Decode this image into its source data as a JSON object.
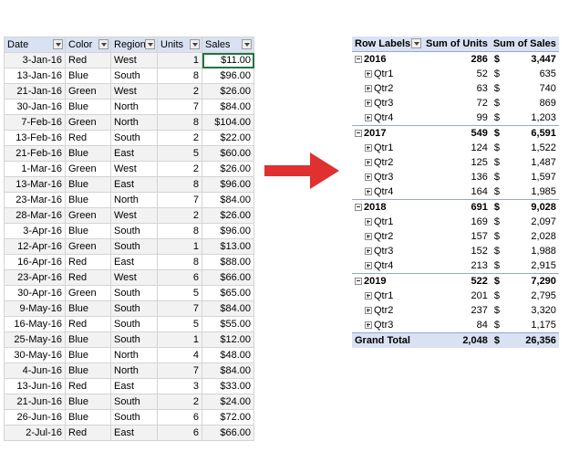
{
  "source": {
    "headers": [
      "Date",
      "Color",
      "Region",
      "Units",
      "Sales"
    ],
    "rows": [
      [
        "3-Jan-16",
        "Red",
        "West",
        "1",
        "$11.00"
      ],
      [
        "13-Jan-16",
        "Blue",
        "South",
        "8",
        "$96.00"
      ],
      [
        "21-Jan-16",
        "Green",
        "West",
        "2",
        "$26.00"
      ],
      [
        "30-Jan-16",
        "Blue",
        "North",
        "7",
        "$84.00"
      ],
      [
        "7-Feb-16",
        "Green",
        "North",
        "8",
        "$104.00"
      ],
      [
        "13-Feb-16",
        "Red",
        "South",
        "2",
        "$22.00"
      ],
      [
        "21-Feb-16",
        "Blue",
        "East",
        "5",
        "$60.00"
      ],
      [
        "1-Mar-16",
        "Green",
        "West",
        "2",
        "$26.00"
      ],
      [
        "13-Mar-16",
        "Blue",
        "East",
        "8",
        "$96.00"
      ],
      [
        "23-Mar-16",
        "Blue",
        "North",
        "7",
        "$84.00"
      ],
      [
        "28-Mar-16",
        "Green",
        "West",
        "2",
        "$26.00"
      ],
      [
        "3-Apr-16",
        "Blue",
        "South",
        "8",
        "$96.00"
      ],
      [
        "12-Apr-16",
        "Green",
        "South",
        "1",
        "$13.00"
      ],
      [
        "16-Apr-16",
        "Red",
        "East",
        "8",
        "$88.00"
      ],
      [
        "23-Apr-16",
        "Red",
        "West",
        "6",
        "$66.00"
      ],
      [
        "30-Apr-16",
        "Green",
        "South",
        "5",
        "$65.00"
      ],
      [
        "9-May-16",
        "Blue",
        "South",
        "7",
        "$84.00"
      ],
      [
        "16-May-16",
        "Red",
        "South",
        "5",
        "$55.00"
      ],
      [
        "25-May-16",
        "Blue",
        "South",
        "1",
        "$12.00"
      ],
      [
        "30-May-16",
        "Blue",
        "North",
        "4",
        "$48.00"
      ],
      [
        "4-Jun-16",
        "Blue",
        "North",
        "7",
        "$84.00"
      ],
      [
        "13-Jun-16",
        "Red",
        "East",
        "3",
        "$33.00"
      ],
      [
        "21-Jun-16",
        "Blue",
        "South",
        "2",
        "$24.00"
      ],
      [
        "26-Jun-16",
        "Blue",
        "South",
        "6",
        "$72.00"
      ],
      [
        "2-Jul-16",
        "Red",
        "East",
        "6",
        "$66.00"
      ]
    ]
  },
  "pivot": {
    "headers": {
      "row_labels": "Row Labels",
      "units": "Sum of Units",
      "sales": "Sum of Sales"
    },
    "currency_symbol": "$",
    "groups": [
      {
        "label": "2016",
        "units": "286",
        "sales": "3,447",
        "quarters": [
          {
            "label": "Qtr1",
            "units": "52",
            "sales": "635"
          },
          {
            "label": "Qtr2",
            "units": "63",
            "sales": "740"
          },
          {
            "label": "Qtr3",
            "units": "72",
            "sales": "869"
          },
          {
            "label": "Qtr4",
            "units": "99",
            "sales": "1,203"
          }
        ]
      },
      {
        "label": "2017",
        "units": "549",
        "sales": "6,591",
        "quarters": [
          {
            "label": "Qtr1",
            "units": "124",
            "sales": "1,522"
          },
          {
            "label": "Qtr2",
            "units": "125",
            "sales": "1,487"
          },
          {
            "label": "Qtr3",
            "units": "136",
            "sales": "1,597"
          },
          {
            "label": "Qtr4",
            "units": "164",
            "sales": "1,985"
          }
        ]
      },
      {
        "label": "2018",
        "units": "691",
        "sales": "9,028",
        "quarters": [
          {
            "label": "Qtr1",
            "units": "169",
            "sales": "2,097"
          },
          {
            "label": "Qtr2",
            "units": "157",
            "sales": "2,028"
          },
          {
            "label": "Qtr3",
            "units": "152",
            "sales": "1,988"
          },
          {
            "label": "Qtr4",
            "units": "213",
            "sales": "2,915"
          }
        ]
      },
      {
        "label": "2019",
        "units": "522",
        "sales": "7,290",
        "quarters": [
          {
            "label": "Qtr1",
            "units": "201",
            "sales": "2,795"
          },
          {
            "label": "Qtr2",
            "units": "237",
            "sales": "3,320"
          },
          {
            "label": "Qtr3",
            "units": "84",
            "sales": "1,175"
          }
        ]
      }
    ],
    "grand_total": {
      "label": "Grand Total",
      "units": "2,048",
      "sales": "26,356"
    }
  },
  "colors": {
    "header_fill": "#d9e1f2",
    "band_fill": "#f2f2f2",
    "arrow": "#e0302f",
    "selection": "#217346"
  }
}
